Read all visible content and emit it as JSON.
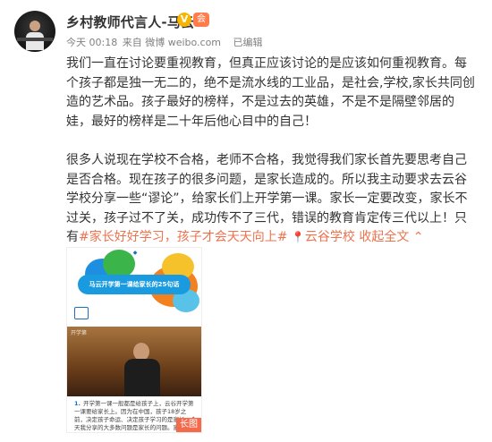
{
  "author": {
    "name": "乡村教师代言人-马云",
    "verified_badge": "V",
    "vip_badge": "会"
  },
  "meta": {
    "time": "今天 00:18",
    "source": "来自 微博 weibo.com",
    "edited": "已编辑"
  },
  "post": {
    "para1": "我们一直在讨论要重视教育，但真正应该讨论的是应该如何重视教育。每个孩子都是独一无二的，绝不是流水线的工业品，是社会,学校,家长共同创造的艺术品。孩子最好的榜样，不是过去的英雄，不是不是隔壁邻居的娃，最好的榜样是二十年后他心目中的自己！",
    "para2_a": "很多人说现在学校不合格，老师不合格，我觉得我们家长首先要思考自己是否合格。现在孩子的很多问题，是家长造成的。所以我主动要求去云谷学校分享一些“谬论”，给家长们上开学第一课。家长一定要改变，家长不过关，孩子过不了关，成功传不了三代，错误的教育肯定传三代以上！只有",
    "hashtag": "#家长好好学习，孩子才会天天向上#",
    "location_icon": "📍",
    "location": "云谷学校",
    "collapse": "收起全文",
    "collapse_icon": "⌃"
  },
  "image": {
    "banner_title": "马云开学第一课给家长的25句话",
    "photo_label": "开学第",
    "text_num": "1.",
    "text_body": "开学第一课一般都是给孩子上，云谷开学第一课要给家长上。因为在中国，孩子18岁之前，决定孩子命运、决定孩子学习的是家长，今天我分享的大多数问题是家长的问题。家长好好学习",
    "long_image_label": "长图"
  },
  "colors": {
    "accent": "#eb7350",
    "verified": "#f7b500"
  }
}
